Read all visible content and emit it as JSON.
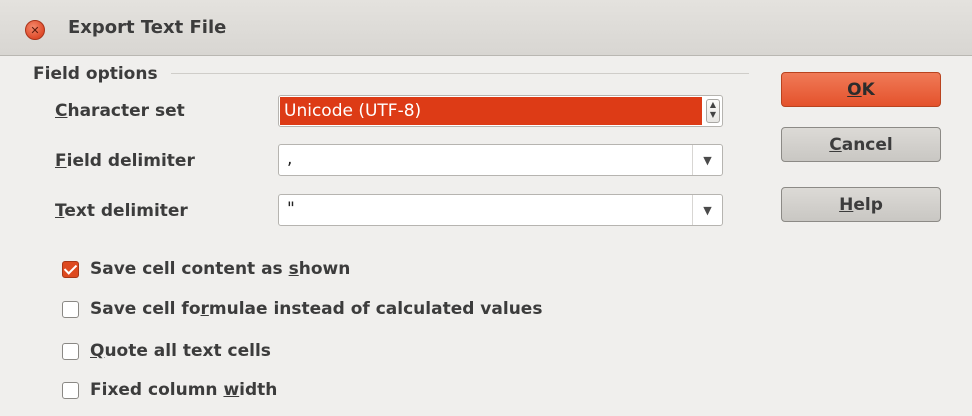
{
  "window": {
    "title": "Export Text File"
  },
  "field_options": {
    "section_label": "Field options",
    "character_set": {
      "label_mnemonic": "C",
      "label_rest": "haracter set",
      "value": "Unicode (UTF-8)",
      "highlight_color": "#dd3b16"
    },
    "field_delimiter": {
      "label_mnemonic": "F",
      "label_rest": "ield delimiter",
      "value": ","
    },
    "text_delimiter": {
      "label_mnemonic": "T",
      "label_rest": "ext delimiter",
      "value": "\""
    }
  },
  "options": [
    {
      "pre": "Save cell content as ",
      "mnemonic": "s",
      "post": "hown",
      "checked": true
    },
    {
      "pre": "Save cell fo",
      "mnemonic": "r",
      "post": "mulae instead of calculated values",
      "checked": false
    },
    {
      "pre": "",
      "mnemonic": "Q",
      "post": "uote all text cells",
      "checked": false
    },
    {
      "pre": "Fixed column ",
      "mnemonic": "w",
      "post": "idth",
      "checked": false
    }
  ],
  "buttons": {
    "ok": {
      "mnemonic": "O",
      "rest": "K"
    },
    "cancel": {
      "mnemonic": "C",
      "rest": "ancel"
    },
    "help": {
      "mnemonic": "H",
      "rest": "elp"
    }
  },
  "icons": {
    "close": "close-icon",
    "spin": "spin-arrows-icon",
    "dropdown": "chevron-down-icon"
  },
  "colors": {
    "accent": "#dd4a20",
    "ok_button": "#e8603a"
  }
}
